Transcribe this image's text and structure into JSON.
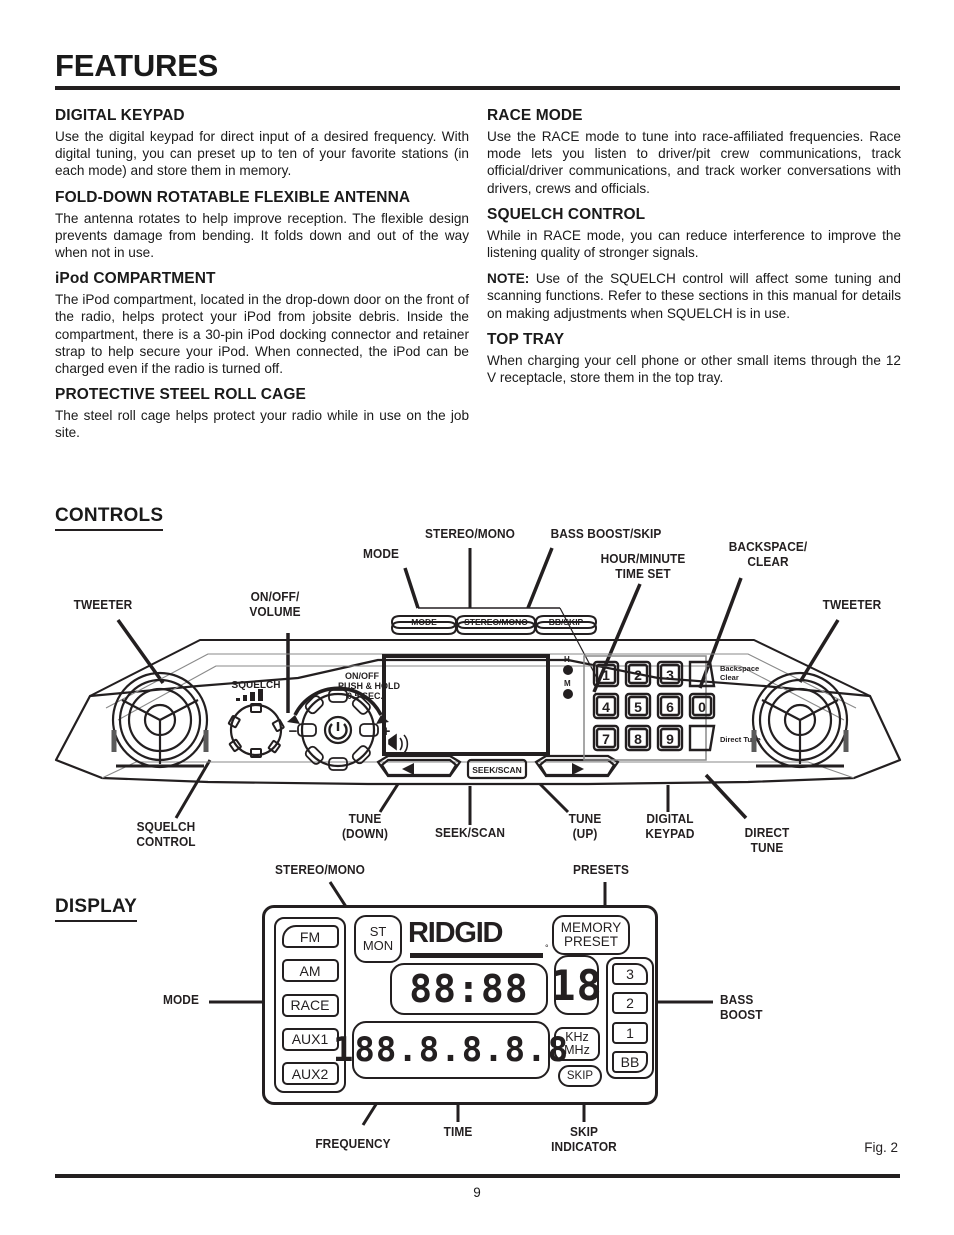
{
  "document": {
    "title": "FEATURES",
    "page_number": "9",
    "figure_caption": "Fig. 2"
  },
  "left_column": [
    {
      "heading": "DIGITAL KEYPAD",
      "body": "Use the digital keypad for direct input of a desired frequency. With digital tuning, you can preset up to ten of your favorite stations (in each mode) and store them in memory."
    },
    {
      "heading": "FOLD-DOWN ROTATABLE FLEXIBLE ANTENNA",
      "body": "The antenna rotates to help improve reception. The flexible design prevents damage from bending. It folds down and out of the way when not in use."
    },
    {
      "heading": "iPod COMPARTMENT",
      "body": "The iPod compartment, located in the drop-down door on the front of the radio, helps protect your iPod from jobsite debris. Inside the compartment, there is a 30-pin iPod docking connector and retainer strap to help secure your iPod. When connected, the iPod can be charged even if the radio is turned off."
    },
    {
      "heading": "PROTECTIVE STEEL ROLL CAGE",
      "body": "The steel roll cage helps protect your radio while in use on the job site."
    }
  ],
  "right_column": [
    {
      "heading": "RACE MODE",
      "body": "Use the RACE mode to tune into race-affiliated frequencies. Race mode lets you listen to driver/pit crew communications, track official/driver communications, and track worker conversations with drivers, crews and officials."
    },
    {
      "heading": "SQUELCH CONTROL",
      "body": "While in RACE mode, you can reduce interference to improve the listening quality of stronger signals."
    },
    {
      "heading": "",
      "note_label": "NOTE:",
      "body": " Use of the SQUELCH control will affect some tuning and scanning functions. Refer to these sections in this manual for details on making adjustments when SQUELCH is in use."
    },
    {
      "heading": "TOP TRAY",
      "body": "When charging your cell phone or other small items through the 12 V receptacle, store them in the top tray."
    }
  ],
  "controls": {
    "section_heading": "CONTROLS",
    "callouts": {
      "tweeter_left": "TWEETER",
      "on_off_volume": "ON/OFF/\nVOLUME",
      "mode": "MODE",
      "stereo_mono_top": "STEREO/MONO",
      "bass_boost_skip": "BASS BOOST/SKIP",
      "hour_minute_time_set": "HOUR/MINUTE\nTIME SET",
      "backspace_clear": "BACKSPACE/\nCLEAR",
      "tweeter_right": "TWEETER",
      "squelch_control": "SQUELCH\nCONTROL",
      "tune_down": "TUNE\n(DOWN)",
      "seek_scan": "SEEK/SCAN",
      "tune_up": "TUNE\n(UP)",
      "digital_keypad": "DIGITAL\nKEYPAD",
      "direct_tune": "DIRECT\nTUNE"
    },
    "panel_labels": {
      "squelch": "SQUELCH",
      "on_off_push_hold": "ON/OFF\nPUSH & HOLD\n0.5 SEC.",
      "minus": "−",
      "plus": "+",
      "backspace_clear": "Backspace\nClear",
      "direct_tune": "Direct Tune",
      "hour_dot": "H",
      "minute_dot": "M"
    },
    "buttons": {
      "mode": "MODE",
      "stereo_mono": "STEREO/MONO",
      "bb_skip": "BB/SKIP",
      "seek_scan": "SEEK/SCAN",
      "tune_down_glyph": "◀",
      "tune_up_glyph": "▶"
    },
    "keypad_keys": [
      "1",
      "2",
      "3",
      "4",
      "5",
      "6",
      "0",
      "7",
      "8",
      "9"
    ]
  },
  "display": {
    "section_heading": "DISPLAY",
    "callouts": {
      "stereo_mono": "STEREO/MONO",
      "presets": "PRESETS",
      "mode": "MODE",
      "bass_boost": "BASS\nBOOST",
      "frequency": "FREQUENCY",
      "time": "TIME",
      "skip_indicator": "SKIP\nINDICATOR"
    },
    "mode_segments": [
      "FM",
      "AM",
      "RACE",
      "AUX1",
      "AUX2"
    ],
    "stereo_mono_indicator": {
      "line1": "ST",
      "line2": "MON"
    },
    "brand": "RIDGID",
    "brand_reg": "°",
    "memory_preset": {
      "line1": "MEMORY",
      "line2": "PRESET"
    },
    "memory_digit": "18",
    "time_value": "88:88",
    "frequency_value": "188.8.8.8.8",
    "units": {
      "line1": "KHz",
      "line2": "MHz"
    },
    "skip_label": "SKIP",
    "preset_segments": [
      "3",
      "2",
      "1",
      "BB"
    ]
  },
  "colors": {
    "ink": "#231f20",
    "paper": "#ffffff"
  }
}
